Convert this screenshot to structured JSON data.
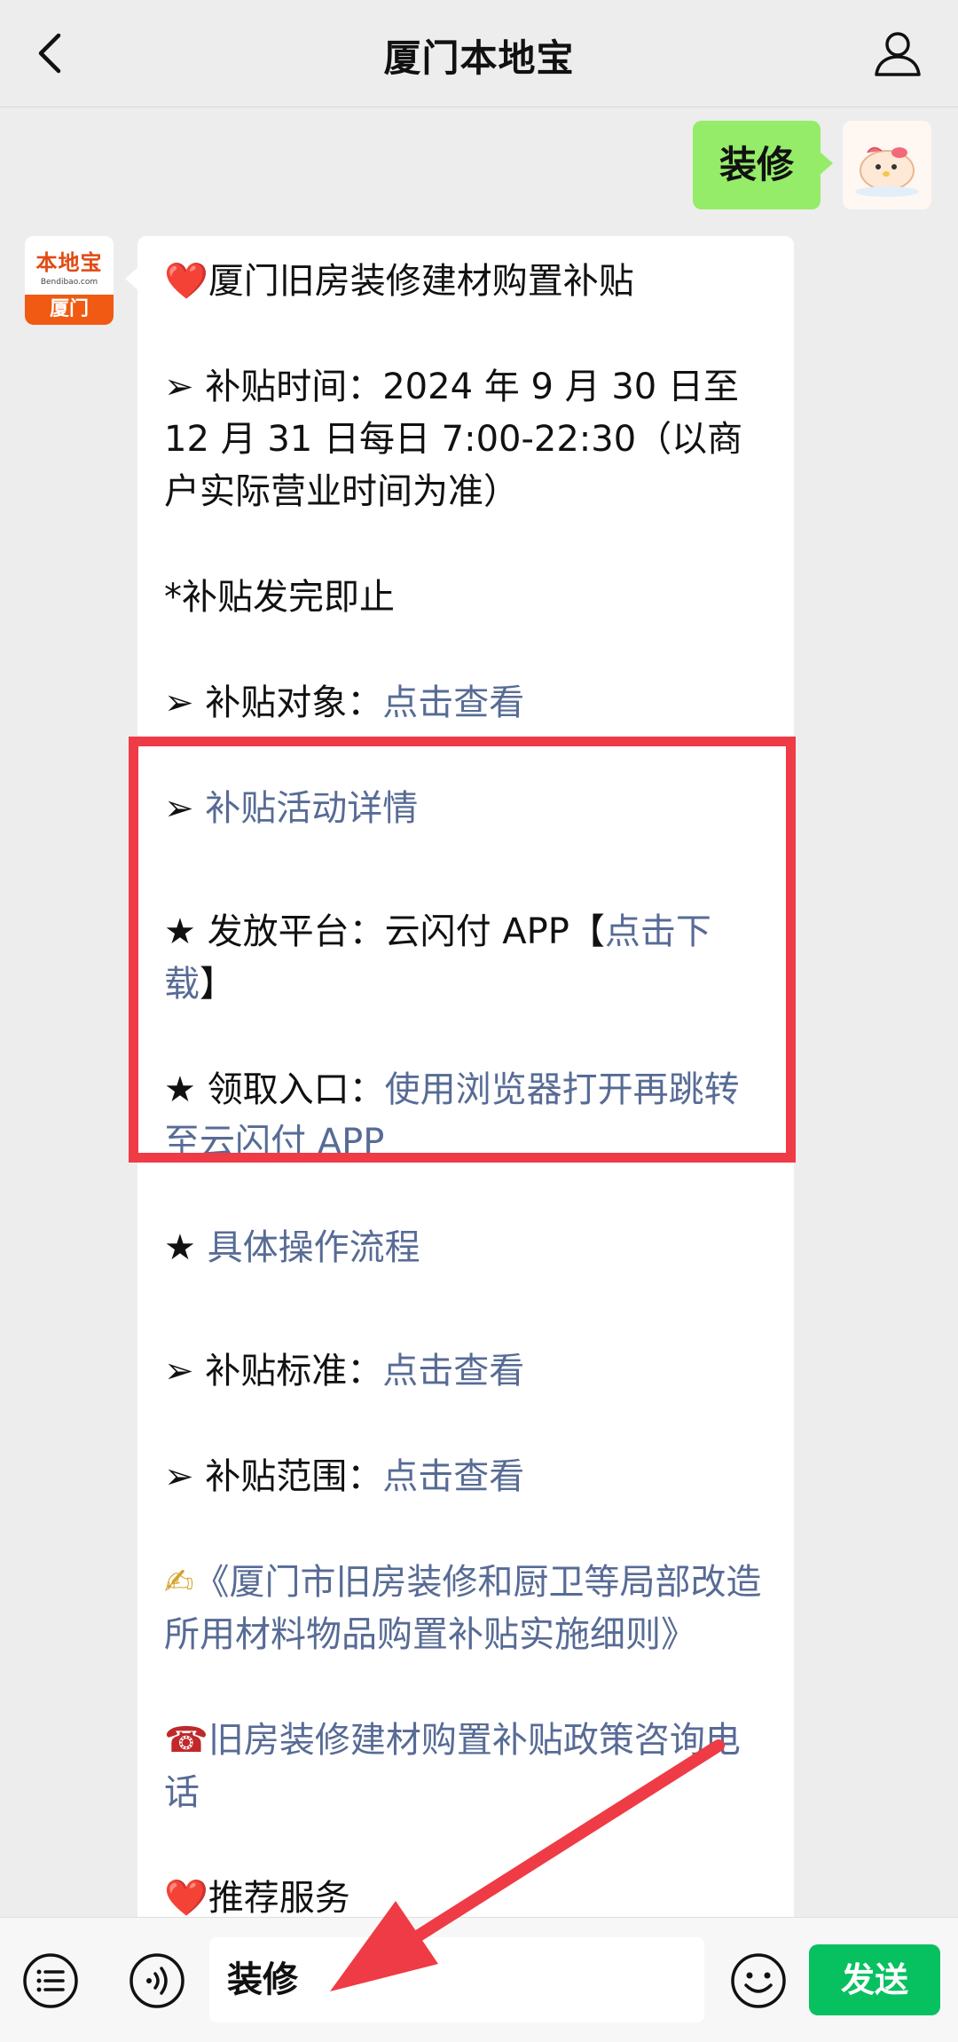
{
  "header": {
    "title": "厦门本地宝"
  },
  "outgoing": {
    "text": "装修"
  },
  "bot": {
    "avatar_logo": "本地宝",
    "avatar_site": "Bendibao.com",
    "avatar_city": "厦门"
  },
  "message": {
    "heart": "❤️",
    "title": "厦门旧房装修建材购置补贴",
    "time_prefix": "➢ 补贴时间：",
    "time_value": "2024 年 9 月 30 日至 12 月 31 日每日 7:00-22:30（以商户实际营业时间为准）",
    "note": "*补贴发完即止",
    "target_label": "➢ 补贴对象：",
    "target_link": "点击查看",
    "detail_arrow": "➢ ",
    "detail_link": "补贴活动详情",
    "platform_label": "★ 发放平台：云闪付 APP【",
    "platform_link": "点击下载",
    "platform_close": "】",
    "entry_label": "★ 领取入口：",
    "entry_link": "使用浏览器打开再跳转至云闪付 APP",
    "process_star": "★ ",
    "process_link": "具体操作流程",
    "standard_label": "➢ 补贴标准：",
    "standard_link": "点击查看",
    "scope_label": "➢ 补贴范围：",
    "scope_link": "点击查看",
    "pen": "✍",
    "rules_link": "《厦门市旧房装修和厨卫等局部改造所用材料物品购置补贴实施细则》",
    "phone": "☎",
    "phone_link": "旧房装修建材购置补贴政策咨询电话",
    "heart2": "❤️",
    "recommend": "推荐服务"
  },
  "input": {
    "value": "装修"
  },
  "send_label": "发送",
  "colors": {
    "bubble_out": "#95ec69",
    "link": "#576b95",
    "highlight": "#ef3b45",
    "send": "#07c160"
  }
}
